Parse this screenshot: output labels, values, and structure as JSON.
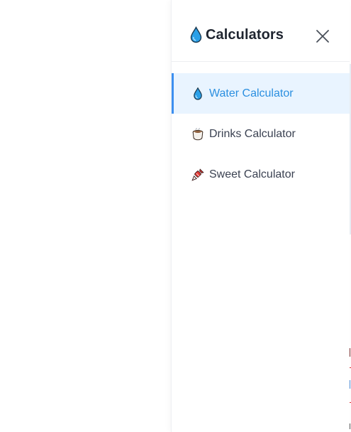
{
  "drawer": {
    "title": "Calculators",
    "title_icon": "water-drop-icon",
    "close_icon": "close-icon",
    "items": [
      {
        "label": "Water Calculator",
        "icon": "water-drop-icon",
        "active": true
      },
      {
        "label": "Drinks Calculator",
        "icon": "hot-drink-icon",
        "active": false
      },
      {
        "label": "Sweet Calculator",
        "icon": "candy-icon",
        "active": false
      }
    ]
  },
  "colors": {
    "accent": "#3c8ff0",
    "active_text": "#2b8fe0",
    "active_bg": "#e9f4ff",
    "title": "#1f2530",
    "text": "#3b4252"
  }
}
